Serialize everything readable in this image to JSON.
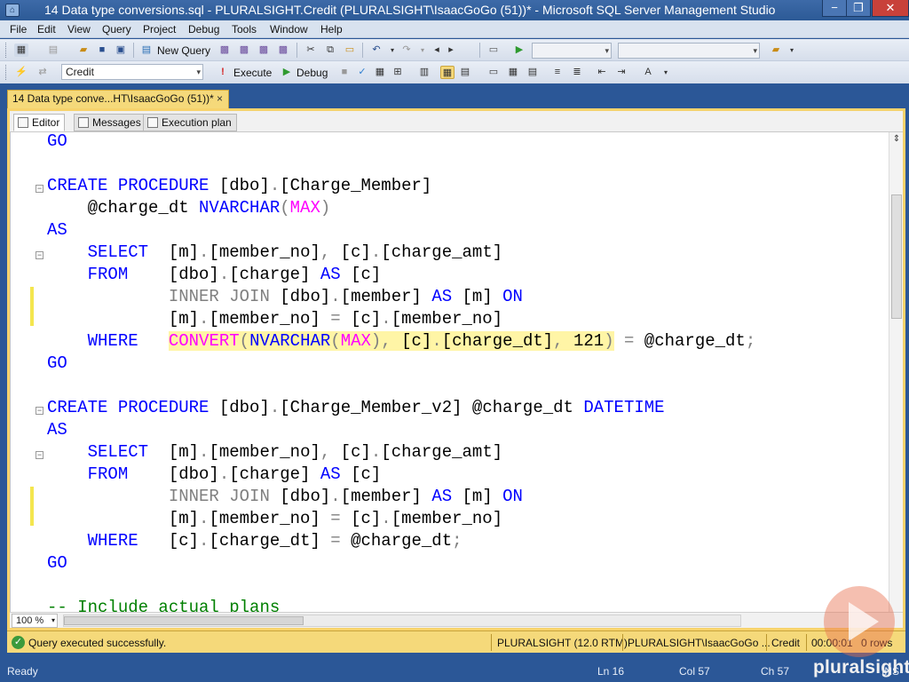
{
  "window": {
    "title": "14 Data type conversions.sql - PLURALSIGHT.Credit (PLURALSIGHT\\IsaacGoGo (51))* - Microsoft SQL Server Management Studio",
    "minimize": "−",
    "maximize": "❐",
    "close": "✕"
  },
  "menu": [
    "File",
    "Edit",
    "View",
    "Query",
    "Project",
    "Debug",
    "Tools",
    "Window",
    "Help"
  ],
  "toolbar1": {
    "new_query_label": "New Query"
  },
  "toolbar2": {
    "database_value": "Credit",
    "execute_label": "Execute",
    "debug_label": "Debug"
  },
  "document_tab": {
    "label": "14 Data type conve...HT\\IsaacGoGo (51))*",
    "close": "×"
  },
  "editor_tabs": [
    "Editor",
    "Messages",
    "Execution plan"
  ],
  "code_lines": [
    "GO",
    "",
    "CREATE PROCEDURE [dbo].[Charge_Member]",
    "    @charge_dt NVARCHAR(MAX)",
    "AS",
    "    SELECT  [m].[member_no], [c].[charge_amt]",
    "    FROM    [dbo].[charge] AS [c]",
    "            INNER JOIN [dbo].[member] AS [m] ON",
    "            [m].[member_no] = [c].[member_no]",
    "    WHERE   CONVERT(NVARCHAR(MAX), [c].[charge_dt], 121) = @charge_dt;",
    "GO",
    "",
    "CREATE PROCEDURE [dbo].[Charge_Member_v2] @charge_dt DATETIME",
    "AS",
    "    SELECT  [m].[member_no], [c].[charge_amt]",
    "    FROM    [dbo].[charge] AS [c]",
    "            INNER JOIN [dbo].[member] AS [m] ON",
    "            [m].[member_no] = [c].[member_no]",
    "    WHERE   [c].[charge_dt] = @charge_dt;",
    "GO",
    "",
    "-- Include actual plans"
  ],
  "zoom": "100 %",
  "query_status": {
    "message": "Query executed successfully.",
    "server": "PLURALSIGHT (12.0 RTM)",
    "user": "PLURALSIGHT\\IsaacGoGo ...",
    "database": "Credit",
    "elapsed": "00:00:01",
    "rows": "0 rows"
  },
  "app_status": {
    "state": "Ready",
    "line": "Ln 16",
    "col": "Col 57",
    "ch": "Ch 57",
    "mode": "INS"
  },
  "watermark": "pluralsight",
  "colors": {
    "keyword": "#0000ff",
    "function": "#ff00ff",
    "operator_gray": "#808080",
    "comment": "#008000",
    "window_chrome": "#2b5797",
    "active_tab": "#f5d97a"
  }
}
